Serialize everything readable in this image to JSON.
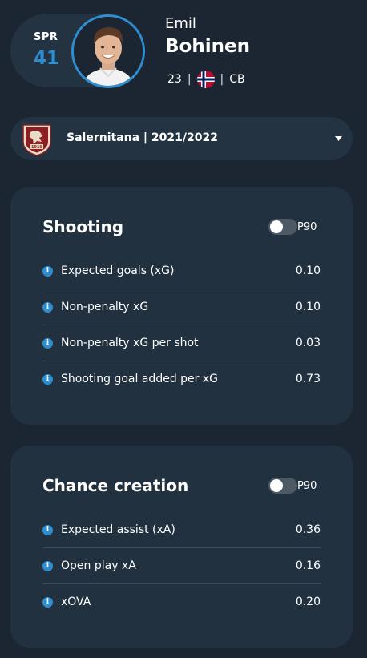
{
  "player": {
    "spr_label": "SPR",
    "spr_value": "41",
    "first_name": "Emil",
    "last_name": "Bohinen",
    "age": "23",
    "separator": "|",
    "country_flag": "norway-flag-icon",
    "position": "CB"
  },
  "team_selector": {
    "label": "Salernitana | 2021/2022",
    "crest_text": "1919"
  },
  "cards": [
    {
      "title": "Shooting",
      "toggle_label": "P90",
      "toggle_on": false,
      "rows": [
        {
          "label": "Expected goals (xG)",
          "value": "0.10"
        },
        {
          "label": "Non-penalty xG",
          "value": "0.10"
        },
        {
          "label": "Non-penalty xG per shot",
          "value": "0.03"
        },
        {
          "label": "Shooting goal added per xG",
          "value": "0.73"
        }
      ]
    },
    {
      "title": "Chance creation",
      "toggle_label": "P90",
      "toggle_on": false,
      "rows": [
        {
          "label": "Expected assist (xA)",
          "value": "0.36"
        },
        {
          "label": "Open play xA",
          "value": "0.16"
        },
        {
          "label": "xOVA",
          "value": "0.20"
        }
      ]
    }
  ],
  "colors": {
    "background": "#1b2632",
    "card": "#213140",
    "accent": "#2d8fd1"
  }
}
